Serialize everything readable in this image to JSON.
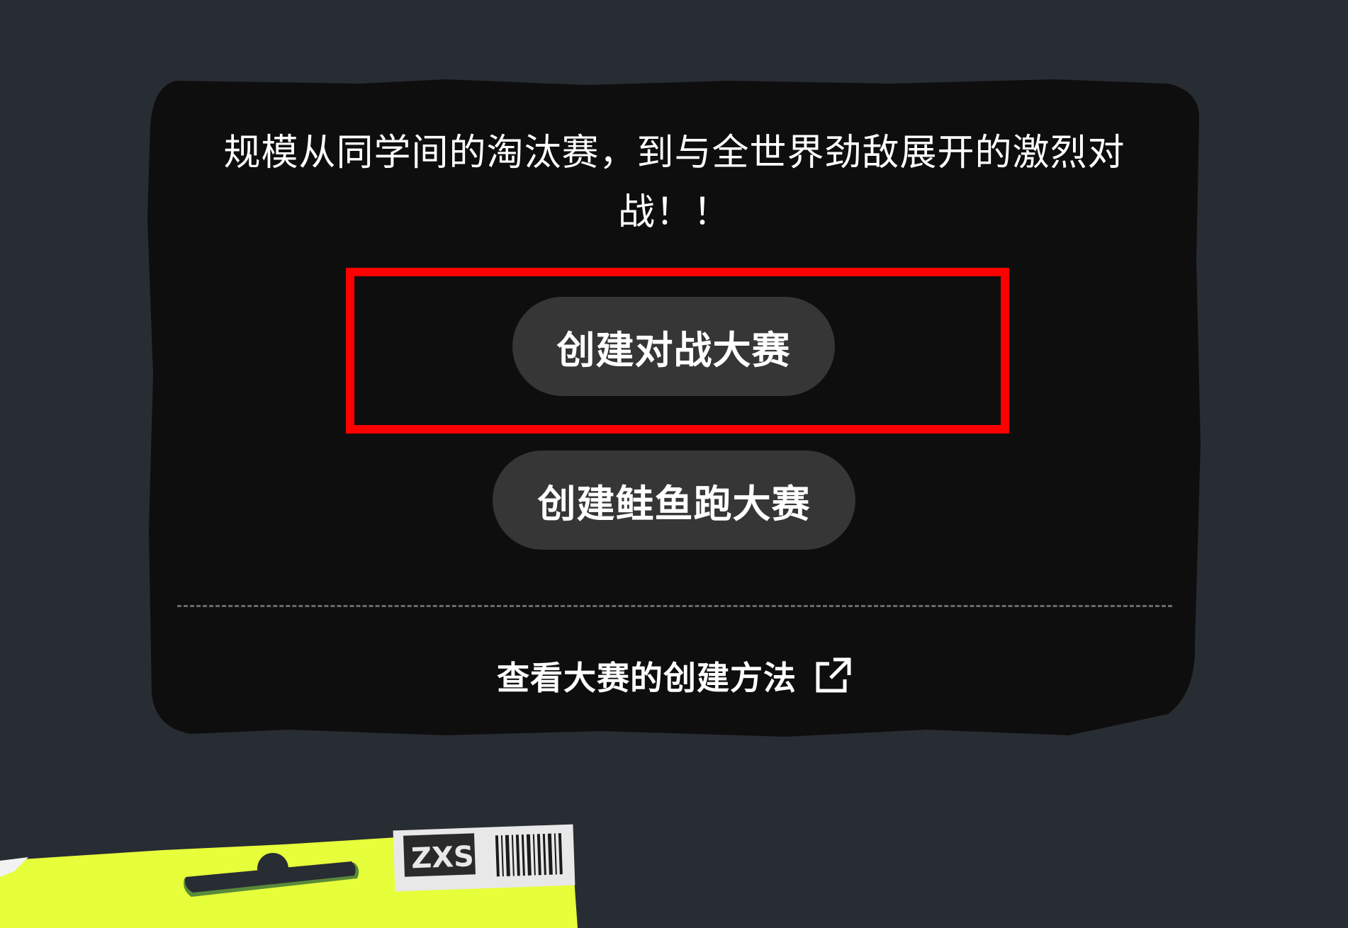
{
  "card": {
    "description": "规模从同学间的淘汰赛，到与全世界劲敌展开的激烈对战！！",
    "buttons": {
      "create_battle": "创建对战大赛",
      "create_salmon": "创建鲑鱼跑大赛"
    },
    "link": {
      "label": "查看大赛的创建方法",
      "icon": "external-link-icon"
    }
  },
  "decor": {
    "sticker_text": "ZXSZ"
  },
  "colors": {
    "background": "#282c33",
    "card": "#0e0e0e",
    "button": "#363636",
    "highlight": "#ff0000",
    "accent": "#e6ff3a"
  }
}
